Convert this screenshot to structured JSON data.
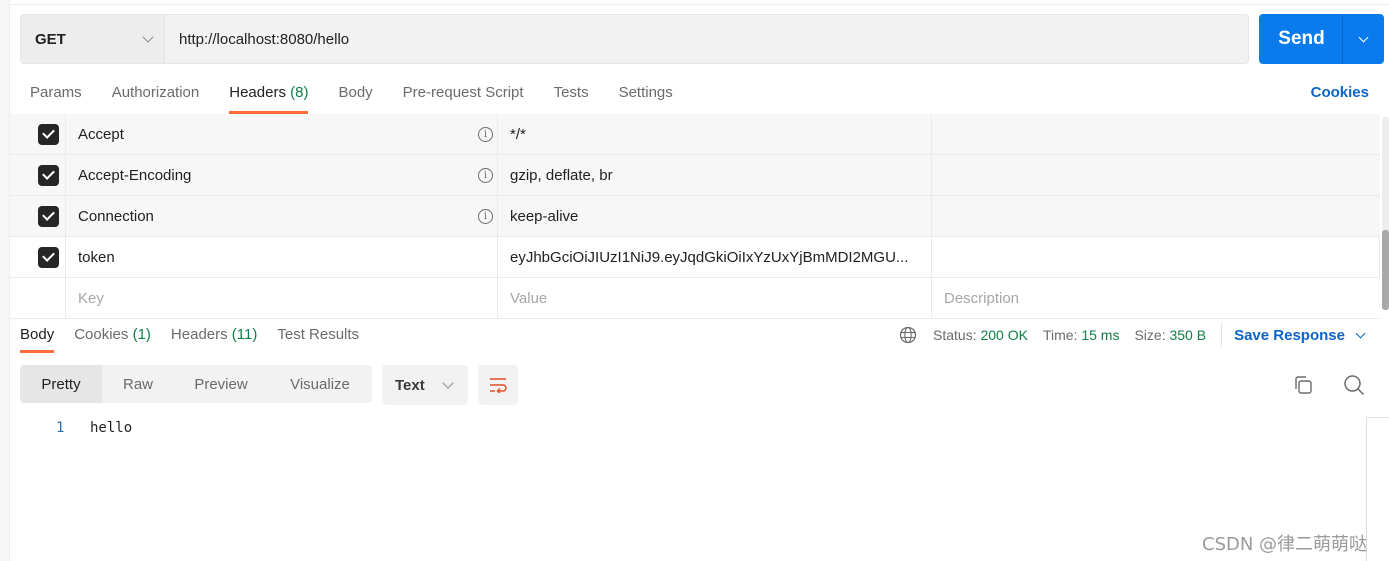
{
  "request": {
    "method": "GET",
    "url": "http://localhost:8080/hello",
    "send_label": "Send"
  },
  "request_tabs": [
    {
      "label": "Params",
      "count": null,
      "active": false
    },
    {
      "label": "Authorization",
      "count": null,
      "active": false
    },
    {
      "label": "Headers",
      "count": "(8)",
      "active": true
    },
    {
      "label": "Body",
      "count": null,
      "active": false
    },
    {
      "label": "Pre-request Script",
      "count": null,
      "active": false
    },
    {
      "label": "Tests",
      "count": null,
      "active": false
    },
    {
      "label": "Settings",
      "count": null,
      "active": false
    }
  ],
  "cookies_link": "Cookies",
  "headers": {
    "rows": [
      {
        "checked": true,
        "key": "Accept",
        "value": "*/*",
        "description": "",
        "auto": true
      },
      {
        "checked": true,
        "key": "Accept-Encoding",
        "value": "gzip, deflate, br",
        "description": "",
        "auto": true
      },
      {
        "checked": true,
        "key": "Connection",
        "value": "keep-alive",
        "description": "",
        "auto": true
      },
      {
        "checked": true,
        "key": "token",
        "value": "eyJhbGciOiJIUzI1NiJ9.eyJqdGkiOiIxYzUxYjBmMDI2MGU...",
        "description": "",
        "auto": false
      }
    ],
    "placeholders": {
      "key": "Key",
      "value": "Value",
      "description": "Description"
    }
  },
  "response_tabs": [
    {
      "label": "Body",
      "count": null,
      "active": true
    },
    {
      "label": "Cookies",
      "count": "(1)",
      "active": false
    },
    {
      "label": "Headers",
      "count": "(11)",
      "active": false
    },
    {
      "label": "Test Results",
      "count": null,
      "active": false
    }
  ],
  "response_meta": {
    "status_label": "Status:",
    "status_value": "200 OK",
    "time_label": "Time:",
    "time_value": "15 ms",
    "size_label": "Size:",
    "size_value": "350 B",
    "save_label": "Save Response"
  },
  "format": {
    "modes": [
      "Pretty",
      "Raw",
      "Preview",
      "Visualize"
    ],
    "active": "Pretty",
    "language": "Text"
  },
  "response_body": [
    {
      "line": "1",
      "text": "hello"
    }
  ],
  "watermark": "CSDN @律二萌萌哒",
  "colors": {
    "accent": "#ff6c37",
    "primary": "#097bed",
    "link": "#0b64c6",
    "success": "#0f8045"
  }
}
